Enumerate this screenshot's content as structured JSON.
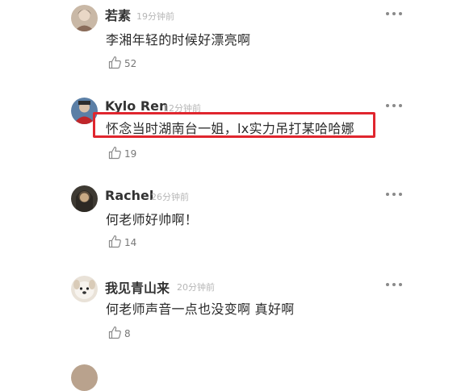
{
  "comments": [
    {
      "name": "若素",
      "time": "19分钟前",
      "text": "李湘年轻的时候好漂亮啊",
      "likes": "52",
      "avatar": "avatar-ruosu"
    },
    {
      "name": "Kylo Ren",
      "time": "12分钟前",
      "text": "怀念当时湖南台一姐，lx实力吊打某哈哈娜",
      "likes": "19",
      "avatar": "avatar-kylo-ren"
    },
    {
      "name": "Rachel",
      "time": "26分钟前",
      "text": "何老师好帅啊！",
      "likes": "14",
      "avatar": "avatar-rachel"
    },
    {
      "name": "我见青山来",
      "time": "20分钟前",
      "text": "何老师声音一点也没变啊 真好啊",
      "likes": "8",
      "avatar": "avatar-dog"
    }
  ],
  "colors": {
    "highlight_border": "#e0262e",
    "timestamp": "#b6b6b6",
    "username": "#333333",
    "body_text": "#2a2a2a"
  },
  "icons": {
    "more": "more-horizontal-icon",
    "like": "thumbs-up-icon"
  }
}
